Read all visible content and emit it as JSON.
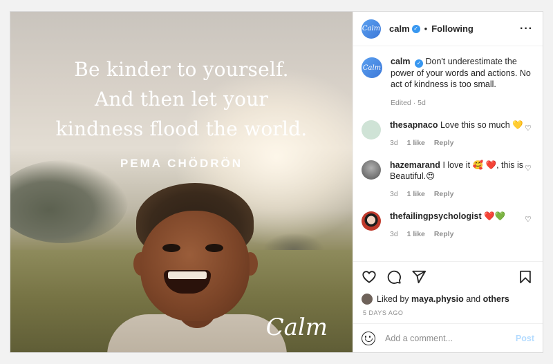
{
  "post": {
    "image": {
      "quote_lines": [
        "Be kinder to yourself.",
        "And then let your",
        "kindness flood the world."
      ],
      "author": "PEMA CHÖDRÖN",
      "logo_text": "Calm"
    },
    "header": {
      "avatar_text": "Calm",
      "username": "calm",
      "separator": "•",
      "follow_status": "Following",
      "more_icon": "···"
    },
    "caption": {
      "username": "calm",
      "text": "Don't underestimate the power of your words and actions. No act of kindness is too small.",
      "meta": "Edited · 5d"
    },
    "comments": [
      {
        "username": "thesapnaco",
        "text": "Love this so much 💛",
        "age": "3d",
        "likes": "1 like",
        "reply": "Reply",
        "avatar_color": "#cfe3d6"
      },
      {
        "username": "hazemarand",
        "text": "I love it 🥰 ❤️, this is Beautiful.😍",
        "age": "3d",
        "likes": "1 like",
        "reply": "Reply",
        "avatar_color": "#8a8a8a"
      },
      {
        "username": "thefailingpsychologist",
        "text": "❤️💚",
        "age": "3d",
        "likes": "1 like",
        "reply": "Reply",
        "avatar_color": "#c0392b"
      }
    ],
    "likes": {
      "prefix": "Liked by",
      "user": "maya.physio",
      "joiner": "and",
      "others": "others"
    },
    "time_ago": "5 DAYS AGO",
    "add_comment": {
      "placeholder": "Add a comment...",
      "post_label": "Post"
    },
    "colors": {
      "verified": "#3897f0",
      "post_disabled": "#b3dbff",
      "muted": "#8e8e8e"
    }
  }
}
